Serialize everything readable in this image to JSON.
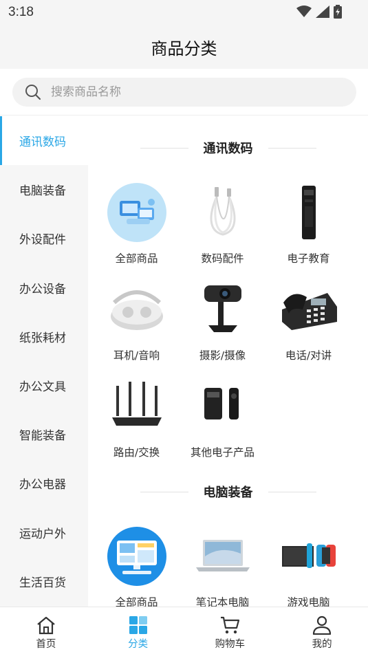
{
  "status_bar": {
    "time": "3:18"
  },
  "header": {
    "title": "商品分类"
  },
  "search": {
    "placeholder": "搜索商品名称"
  },
  "sidebar": {
    "items": [
      {
        "label": "通讯数码",
        "active": true
      },
      {
        "label": "电脑装备"
      },
      {
        "label": "外设配件"
      },
      {
        "label": "办公设备"
      },
      {
        "label": "纸张耗材"
      },
      {
        "label": "办公文具"
      },
      {
        "label": "智能装备"
      },
      {
        "label": "办公电器"
      },
      {
        "label": "运动户外"
      },
      {
        "label": "生活百货"
      }
    ]
  },
  "sections": [
    {
      "title": "通讯数码",
      "items": [
        {
          "label": "全部商品",
          "icon": "all-products-icon"
        },
        {
          "label": "数码配件",
          "icon": "usb-cable-icon"
        },
        {
          "label": "电子教育",
          "icon": "voice-recorder-icon"
        },
        {
          "label": "耳机/音响",
          "icon": "earbuds-case-icon"
        },
        {
          "label": "摄影/摄像",
          "icon": "webcam-icon"
        },
        {
          "label": "电话/对讲",
          "icon": "desk-phone-icon"
        },
        {
          "label": "路由/交换",
          "icon": "router-icon"
        },
        {
          "label": "其他电子产品",
          "icon": "body-camera-icon"
        }
      ]
    },
    {
      "title": "电脑装备",
      "items": [
        {
          "label": "全部商品",
          "icon": "desktop-computer-icon"
        },
        {
          "label": "笔记本电脑",
          "icon": "laptop-icon"
        },
        {
          "label": "游戏电脑",
          "icon": "game-console-icon"
        }
      ]
    }
  ],
  "tabbar": {
    "tabs": [
      {
        "label": "首页",
        "icon": "home-icon"
      },
      {
        "label": "分类",
        "icon": "category-grid-icon",
        "active": true
      },
      {
        "label": "购物车",
        "icon": "cart-icon"
      },
      {
        "label": "我的",
        "icon": "user-icon"
      }
    ]
  },
  "colors": {
    "accent": "#2aa7e6",
    "sidebar_bg": "#f6f6f6",
    "header_bg": "#f5f5f5"
  }
}
